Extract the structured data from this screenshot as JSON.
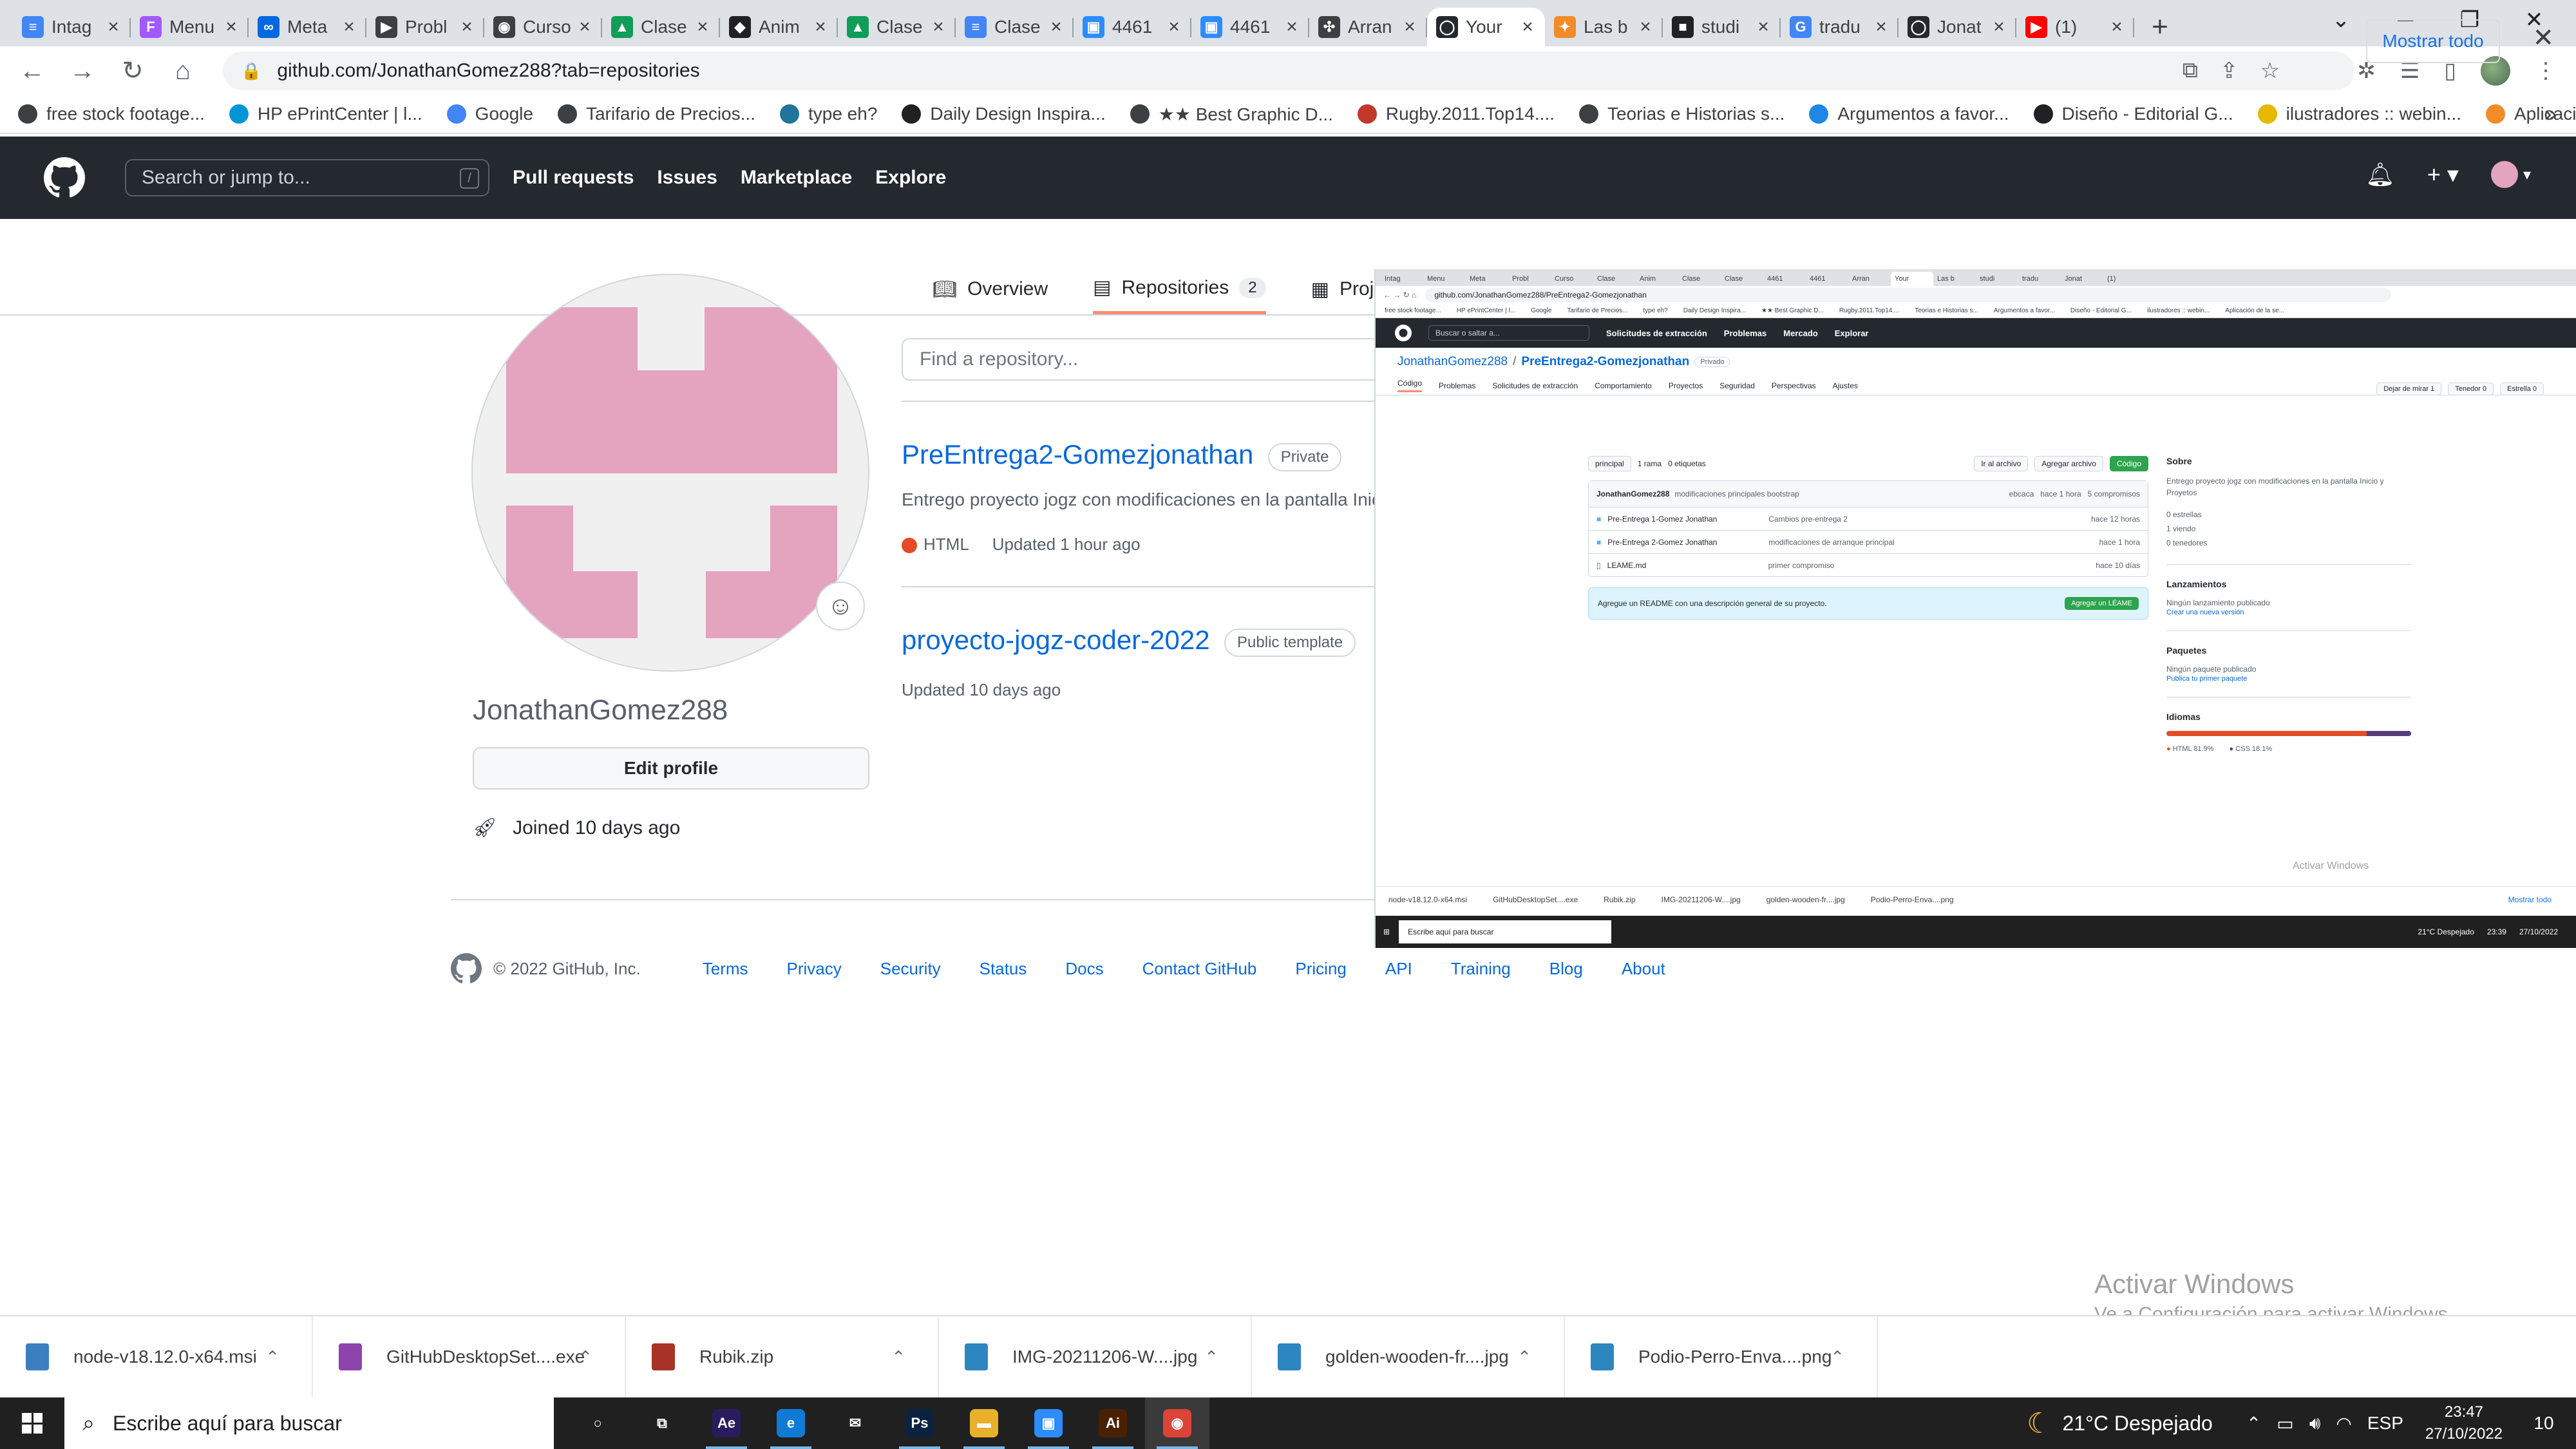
{
  "browser": {
    "tabs": [
      {
        "title": "Intag",
        "color": "#4285f4",
        "glyph": "≡"
      },
      {
        "title": "Menu",
        "color": "#a259ff",
        "glyph": "F"
      },
      {
        "title": "Meta",
        "color": "#0668e1",
        "glyph": "∞"
      },
      {
        "title": "Probl",
        "color": "#3c4043",
        "glyph": "▶"
      },
      {
        "title": "Curso",
        "color": "#3c4043",
        "glyph": "◉"
      },
      {
        "title": "Clase",
        "color": "#0f9d58",
        "glyph": "▲"
      },
      {
        "title": "Anim",
        "color": "#202124",
        "glyph": "◆"
      },
      {
        "title": "Clase",
        "color": "#0f9d58",
        "glyph": "▲"
      },
      {
        "title": "Clase",
        "color": "#4285f4",
        "glyph": "≡"
      },
      {
        "title": "4461",
        "color": "#2d8cff",
        "glyph": "▣"
      },
      {
        "title": "4461",
        "color": "#2d8cff",
        "glyph": "▣"
      },
      {
        "title": "Arran",
        "color": "#3c4043",
        "glyph": "✣"
      },
      {
        "title": "Your",
        "color": "#24292f",
        "glyph": "◯",
        "active": true
      },
      {
        "title": "Las b",
        "color": "#f28c28",
        "glyph": "✦"
      },
      {
        "title": "studi",
        "color": "#202124",
        "glyph": "■"
      },
      {
        "title": "tradu",
        "color": "#4285f4",
        "glyph": "G"
      },
      {
        "title": "Jonat",
        "color": "#24292f",
        "glyph": "◯"
      },
      {
        "title": "(1)",
        "color": "#ff0000",
        "glyph": "▶"
      }
    ],
    "new_tab": "+",
    "url": "github.com/JonathanGomez288?tab=repositories",
    "bookmarks": [
      {
        "label": "free stock footage...",
        "color": "#3c4043"
      },
      {
        "label": "HP ePrintCenter | l...",
        "color": "#0096d6"
      },
      {
        "label": "Google",
        "color": "#4285f4"
      },
      {
        "label": "Tarifario de Precios...",
        "color": "#3c4043"
      },
      {
        "label": "type eh?",
        "color": "#21759b"
      },
      {
        "label": "Daily Design Inspira...",
        "color": "#202124"
      },
      {
        "label": "★★ Best Graphic D...",
        "color": "#3c4043"
      },
      {
        "label": "Rugby.2011.Top14....",
        "color": "#c0392b"
      },
      {
        "label": "Teorias e Historias s...",
        "color": "#3c4043"
      },
      {
        "label": "Argumentos a favor...",
        "color": "#1e88e5"
      },
      {
        "label": "Diseño - Editorial G...",
        "color": "#202124"
      },
      {
        "label": "ilustradores :: webin...",
        "color": "#e6b800"
      },
      {
        "label": "Aplicación de la se...",
        "color": "#f28c28"
      }
    ]
  },
  "github": {
    "search_placeholder": "Search or jump to...",
    "search_shortcut": "/",
    "nav": [
      "Pull requests",
      "Issues",
      "Marketplace",
      "Explore"
    ],
    "profile_tabs": {
      "overview": "Overview",
      "repositories": "Repositories",
      "repositories_count": "2",
      "projects": "Projects"
    },
    "username": "JonathanGomez288",
    "edit_profile": "Edit profile",
    "joined": "Joined 10 days ago",
    "repo_search_placeholder": "Find a repository...",
    "repos": [
      {
        "name": "PreEntrega2-Gomezjonathan",
        "badge": "Private",
        "description": "Entrego proyecto jogz con modificaciones en la pantalla Inicio y Proyetos",
        "language": "HTML",
        "updated": "Updated 1 hour ago"
      },
      {
        "name": "proyecto-jogz-coder-2022",
        "badge": "Public template",
        "updated": "Updated 10 days ago"
      }
    ],
    "footer": {
      "copyright": "© 2022 GitHub, Inc.",
      "links": [
        "Terms",
        "Privacy",
        "Security",
        "Status",
        "Docs",
        "Contact GitHub",
        "Pricing",
        "API",
        "Training",
        "Blog",
        "About"
      ]
    }
  },
  "inset": {
    "url": "github.com/JonathanGomez288/PreEntrega2-Gomezjonathan",
    "search_placeholder": "Buscar o saltar a...",
    "nav": [
      "Solicitudes de extracción",
      "Problemas",
      "Mercado",
      "Explorar"
    ],
    "owner": "JonathanGomez288",
    "repo": "PreEntrega2-Gomezjonathan",
    "private": "Privado",
    "actions": [
      "Dejar de mirar 1",
      "Tenedor 0",
      "Estrella 0"
    ],
    "tabs": [
      "Código",
      "Problemas",
      "Solicitudes de extracción",
      "Comportamiento",
      "Proyectos",
      "Seguridad",
      "Perspectivas",
      "Ajustes"
    ],
    "branch": "principal",
    "branches": "1 rama",
    "tags": "0 etiquetas",
    "goto_file": "Ir al archivo",
    "add_file": "Agregar archivo",
    "code": "Código",
    "commit": {
      "user": "JonathanGomez288",
      "message": "modificaciones principales bootstrap",
      "hash": "ebcaca",
      "when": "hace 1 hora",
      "commits": "5 compromisos"
    },
    "files": [
      {
        "name": "Pre-Entrega 1-Gomez Jonathan",
        "message": "Cambios pre-entrega 2",
        "when": "hace 12 horas"
      },
      {
        "name": "Pre-Entrega 2-Gomez Jonathan",
        "message": "modificaciones de arranque principal",
        "when": "hace 1 hora"
      },
      {
        "name": "LEAME.md",
        "message": "primer compromiso",
        "when": "hace 10 días"
      }
    ],
    "readme_notice": "Agregue un README con una descripción general de su proyecto.",
    "readme_button": "Agregar un LÉAME",
    "about_title": "Sobre",
    "about_text": "Entrego proyecto jogz con modificaciones en la pantalla Inicio y Proyetos",
    "about_stats": [
      "0 estrellas",
      "1 viendo",
      "0 tenedores"
    ],
    "releases_title": "Lanzamientos",
    "releases_text": "Ningún lanzamiento publicado",
    "releases_link": "Crear una nueva versión",
    "packages_title": "Paquetes",
    "packages_text": "Ningún paquete publicado",
    "packages_link": "Publica tu primer paquete",
    "languages_title": "Idiomas",
    "languages": [
      {
        "name": "HTML",
        "percent": 81.9,
        "label": "HTML 81.9%",
        "color": "#e34c26"
      },
      {
        "name": "CSS",
        "percent": 18.1,
        "label": "CSS 18.1%",
        "color": "#563d7c"
      }
    ],
    "downloads": [
      "node-v18.12.0-x64.msi",
      "GitHubDesktopSet....exe",
      "Rubik.zip",
      "IMG-20211206-W....jpg",
      "golden-wooden-fr....jpg",
      "Podio-Perro-Enva....png"
    ],
    "show_all": "Mostrar todo",
    "taskbar_search": "Escribe aquí para buscar",
    "weather": "21°C Despejado",
    "time": "23:39",
    "date": "27/10/2022",
    "activate": "Activar Windows"
  },
  "downloads": {
    "items": [
      {
        "name": "node-v18.12.0-x64.msi",
        "color": "#3c7fbf"
      },
      {
        "name": "GitHubDesktopSet....exe",
        "color": "#8e44ad"
      },
      {
        "name": "Rubik.zip",
        "color": "#a93226"
      },
      {
        "name": "IMG-20211206-W....jpg",
        "color": "#2e86c1"
      },
      {
        "name": "golden-wooden-fr....jpg",
        "color": "#2e86c1"
      },
      {
        "name": "Podio-Perro-Enva....png",
        "color": "#2e86c1"
      }
    ],
    "show_all": "Mostrar todo"
  },
  "windows": {
    "activate_title": "Activar Windows",
    "activate_sub": "Ve a Configuración para activar Windows.",
    "search_placeholder": "Escribe aquí para buscar",
    "weather": "21°C  Despejado",
    "language": "ESP",
    "time": "23:47",
    "date": "27/10/2022",
    "notifications": "10",
    "apps": [
      {
        "name": "cortana",
        "glyph": "○",
        "color": "transparent"
      },
      {
        "name": "task-view",
        "glyph": "⧉",
        "color": "transparent"
      },
      {
        "name": "after-effects",
        "glyph": "Ae",
        "color": "#2a1a5e"
      },
      {
        "name": "edge",
        "glyph": "e",
        "color": "#0f7bd7"
      },
      {
        "name": "mail",
        "glyph": "✉",
        "color": "transparent"
      },
      {
        "name": "photoshop",
        "glyph": "Ps",
        "color": "#0c2340"
      },
      {
        "name": "file-explorer",
        "glyph": "▬",
        "color": "#e8b02b"
      },
      {
        "name": "zoom",
        "glyph": "▣",
        "color": "#2d8cff"
      },
      {
        "name": "illustrator",
        "glyph": "Ai",
        "color": "#4a2000"
      },
      {
        "name": "chrome",
        "glyph": "◉",
        "color": "#db4437"
      }
    ]
  }
}
